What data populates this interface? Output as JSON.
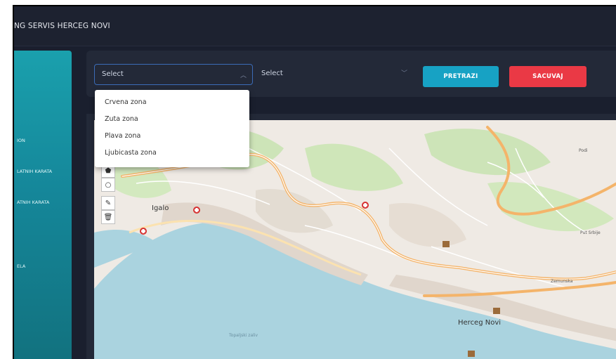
{
  "header": {
    "title": "NG SERVIS HERCEG NOVI"
  },
  "sidebar": {
    "items": [
      {
        "label": "ION"
      },
      {
        "label": "LATNIH KARATA"
      },
      {
        "label": "ATNIH KARATA"
      },
      {
        "label": "ELA"
      }
    ]
  },
  "filters": {
    "zone_select": {
      "value": "Select",
      "open": true
    },
    "second_select": {
      "value": "Select"
    },
    "search_label": "PRETRAZI",
    "save_label": "SACUVAJ"
  },
  "dropdown": {
    "options": [
      "Crvena zona",
      "Zuta zona",
      "Plava zona",
      "Ljubicasta zona"
    ]
  },
  "map": {
    "labels": {
      "igalo": "Igalo",
      "herceg_novi": "Herceg Novi",
      "topaljski_zaliv": "Topaljski zaliv",
      "put_srbije": "Put Srbije",
      "pod": "Podi",
      "zemunska": "Zemunska"
    }
  },
  "colors": {
    "search_button": "#17a2c4",
    "save_button": "#ea3945",
    "sidebar": "#15879a",
    "water": "#aad3df",
    "land": "#efeae4",
    "road_major": "#f7c77d"
  },
  "icons": [
    "chevron-up-icon",
    "chevron-down-icon",
    "polygon-icon",
    "circle-icon",
    "edit-icon",
    "trash-icon",
    "hospital-marker-icon"
  ]
}
